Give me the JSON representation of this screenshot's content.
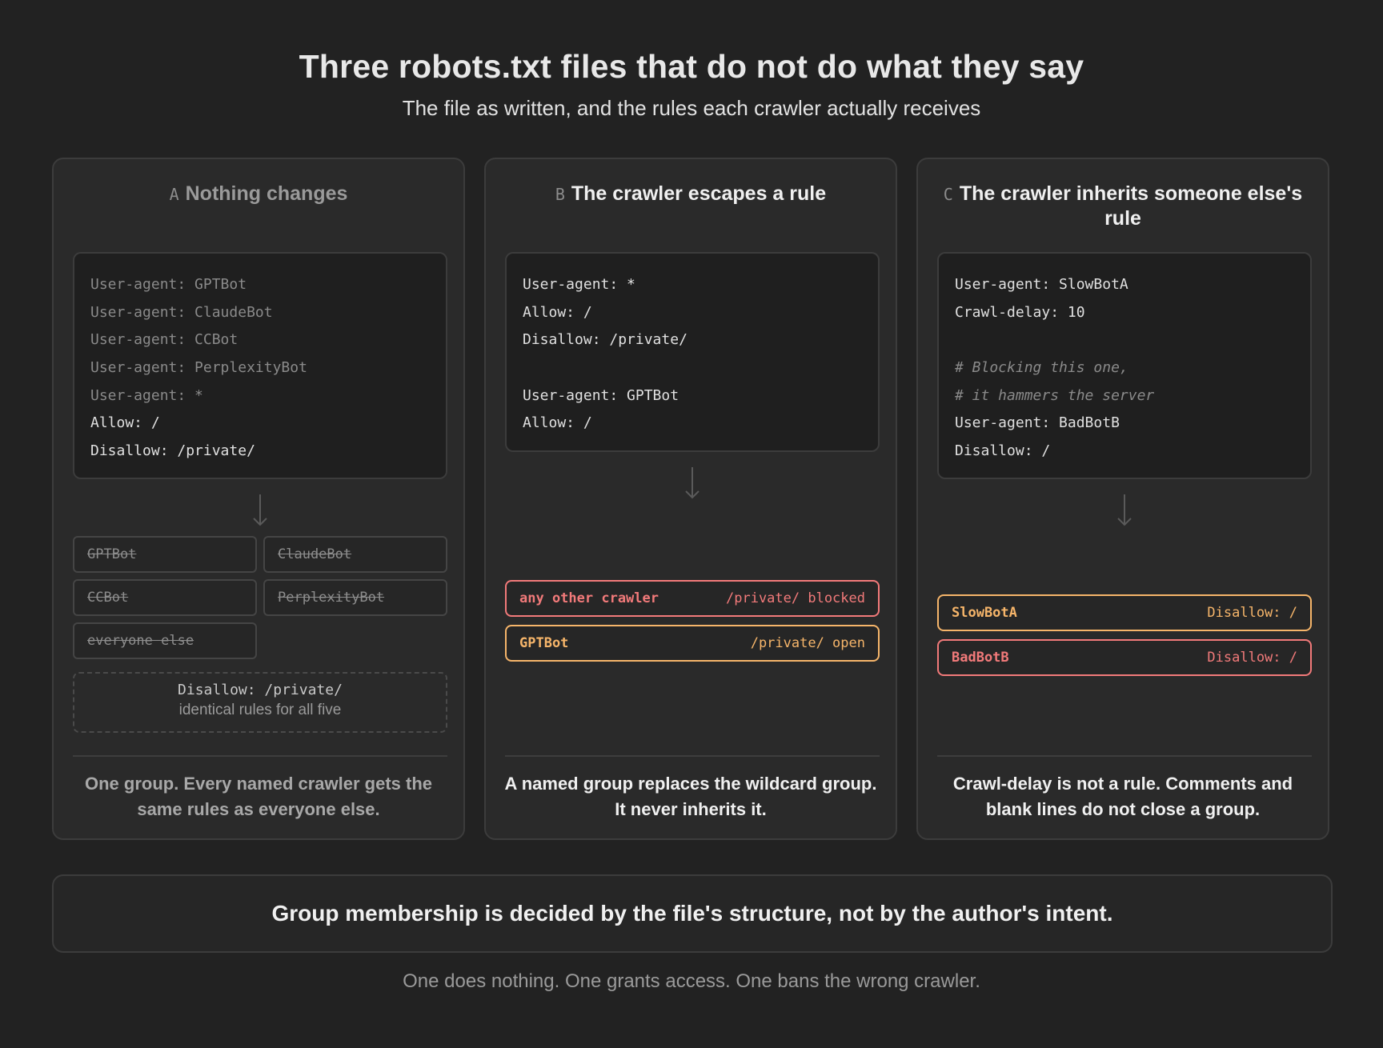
{
  "title": "Three robots.txt files that do not do what they say",
  "subtitle": "The file as written, and the rules each crawler actually receives",
  "panels": [
    {
      "letter": "A",
      "title": "Nothing changes",
      "code": [
        "User-agent: GPTBot",
        "User-agent: ClaudeBot",
        "User-agent: CCBot",
        "User-agent: PerplexityBot",
        "User-agent: *",
        "Allow: /",
        "Disallow: /private/"
      ],
      "chips": [
        "GPTBot",
        "ClaudeBot",
        "CCBot",
        "PerplexityBot",
        "everyone else"
      ],
      "result_rule": "Disallow: /private/",
      "result_note": "identical rules for all five",
      "caption": "One group. Every named crawler gets the same rules as everyone else."
    },
    {
      "letter": "B",
      "title": "The crawler escapes a rule",
      "code": [
        "User-agent: *",
        "Allow: /",
        "Disallow: /private/",
        "",
        "User-agent: GPTBot",
        "Allow: /"
      ],
      "results": [
        {
          "name": "any other crawler",
          "rule": "/private/ blocked",
          "color": "#f27a7a"
        },
        {
          "name": "GPTBot",
          "rule": "/private/ open",
          "color": "#f6b56a"
        }
      ],
      "caption": "A named group replaces the wildcard group. It never inherits it."
    },
    {
      "letter": "C",
      "title": "The crawler inherits someone else's rule",
      "code": [
        "User-agent: SlowBotA",
        "Crawl-delay: 10",
        "",
        "# Blocking this one,",
        "# it hammers the server",
        "User-agent: BadBotB",
        "Disallow: /"
      ],
      "results": [
        {
          "name": "SlowBotA",
          "rule": "Disallow: /",
          "color": "#f6b56a"
        },
        {
          "name": "BadBotB",
          "rule": "Disallow: /",
          "color": "#f27a7a"
        }
      ],
      "caption": "Crawl-delay is not a rule. Comments and blank lines do not close a group."
    }
  ],
  "summary": "Group membership is decided by the file's structure, not by the author's intent.",
  "footer": "One does nothing. One grants access. One bans the wrong crawler."
}
